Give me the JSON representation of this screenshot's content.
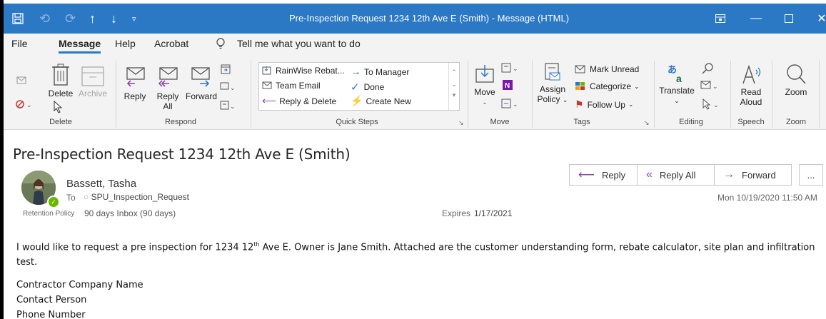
{
  "titlebar": {
    "title": "Pre-Inspection Request 1234 12th Ave E (Smith)  -  Message (HTML)",
    "bg_color": "#2b78c5",
    "quick_access": [
      "save-icon",
      "undo-icon",
      "redo-icon",
      "up-arrow-icon",
      "down-arrow-icon",
      "customize-icon"
    ]
  },
  "tabs": [
    "File",
    "Message",
    "Help",
    "Acrobat"
  ],
  "active_tab": "Message",
  "tell_me": "Tell me what you want to do",
  "ribbon": {
    "delete": {
      "delete_label": "Delete",
      "archive_label": "Archive",
      "group": "Delete"
    },
    "respond": {
      "reply": "Reply",
      "reply_all_1": "Reply",
      "reply_all_2": "All",
      "forward": "Forward",
      "group": "Respond"
    },
    "quick_steps": {
      "items": [
        "RainWise Rebat...",
        "To Manager",
        "Team Email",
        "Done",
        "Reply & Delete",
        "Create New"
      ],
      "group": "Quick Steps"
    },
    "move": {
      "move_label": "Move",
      "group": "Move"
    },
    "tags": {
      "assign_1": "Assign",
      "assign_2": "Policy",
      "mark_unread": "Mark Unread",
      "categorize": "Categorize",
      "follow_up": "Follow Up",
      "group": "Tags"
    },
    "editing": {
      "translate": "Translate",
      "group": "Editing"
    },
    "speech": {
      "read_1": "Read",
      "read_2": "Aloud",
      "group": "Speech"
    },
    "zoom": {
      "zoom_label": "Zoom",
      "group": "Zoom"
    }
  },
  "message": {
    "subject": "Pre-Inspection Request 1234 12th Ave E (Smith)",
    "sender": "Bassett, Tasha",
    "to_label": "To",
    "to_value": "SPU_Inspection_Request",
    "retention_label": "Retention Policy",
    "retention_value": "90 days Inbox (90 days)",
    "expires_label": "Expires",
    "expires_value": "1/17/2021",
    "datetime": "Mon 10/19/2020 11:50 AM",
    "actions": [
      "Reply",
      "Reply All",
      "Forward"
    ],
    "more": "...",
    "body_pre": "I would like to request a pre inspection for 1234 12",
    "body_sup": "th",
    "body_post": " Ave E. Owner is Jane Smith. Attached are the customer understanding form, rebate calculator, site plan and infiltration test.",
    "signature": [
      "Contractor Company Name",
      "Contact Person",
      "Phone Number"
    ]
  }
}
